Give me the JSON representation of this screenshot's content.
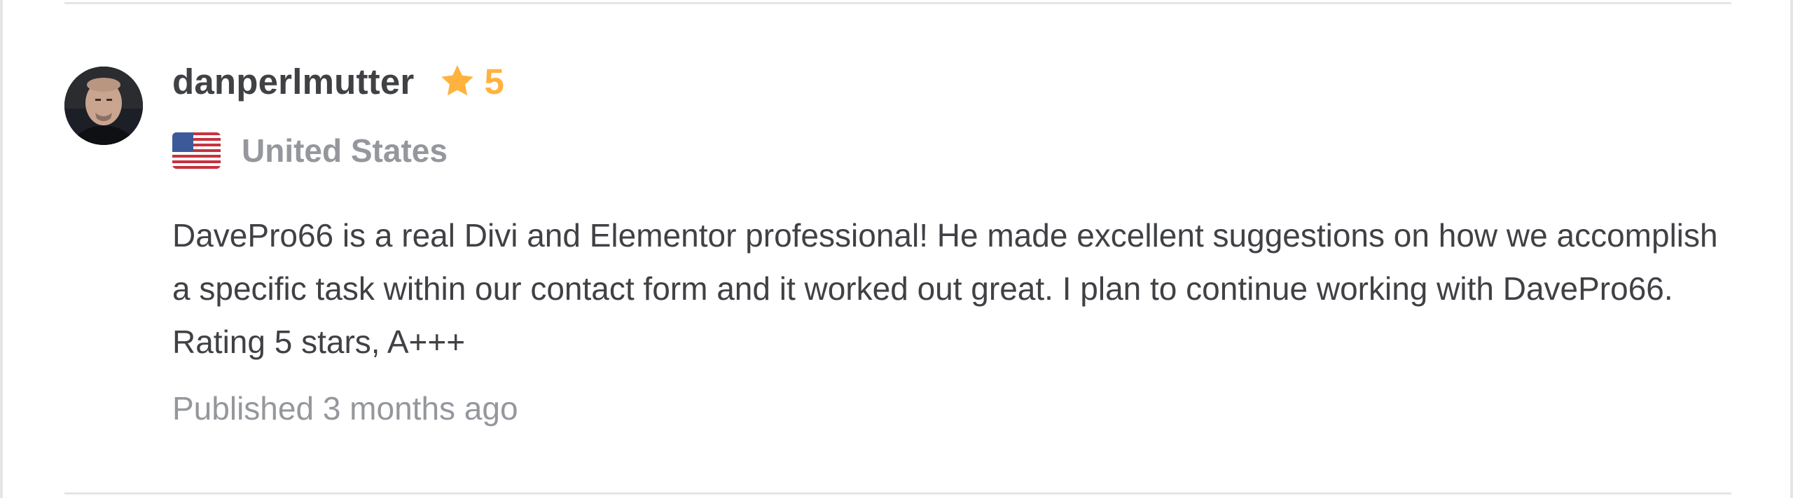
{
  "review": {
    "username": "danperlmutter",
    "rating": "5",
    "country": "United States",
    "text": "DavePro66 is a real Divi and Elementor professional! He made excellent suggestions on how we accomplish a specific task within our contact form and it worked out great. I plan to continue working with DavePro66. Rating 5 stars, A+++",
    "published": "Published 3 months ago"
  },
  "icons": {
    "rating_star": "star-icon",
    "country_flag": "us-flag-icon",
    "avatar": "avatar"
  },
  "colors": {
    "star": "#ffb33e",
    "text_primary": "#404145",
    "text_muted": "#95979d",
    "divider": "#e4e5e7"
  }
}
